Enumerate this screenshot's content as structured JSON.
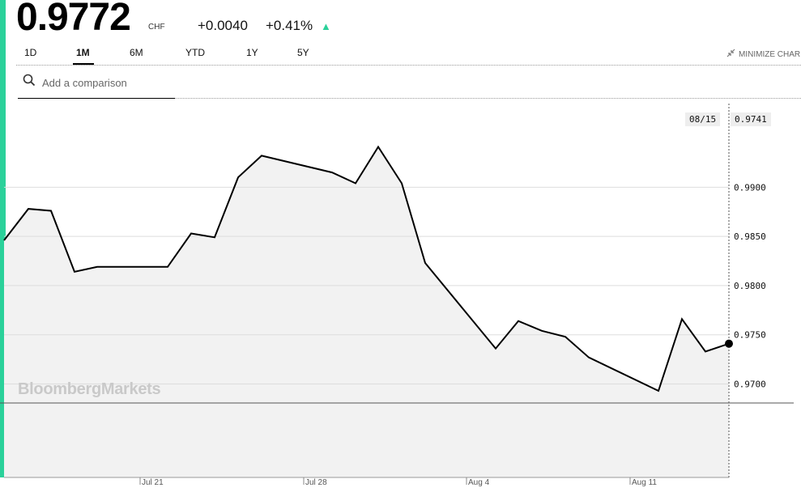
{
  "quote": {
    "price": "0.9772",
    "currency": "CHF",
    "change": "+0.0040",
    "change_pct": "+0.41%",
    "arrow": "▲",
    "accent_color": "#2bd19a",
    "up_color": "#2bd19a"
  },
  "ranges": {
    "items": [
      "1D",
      "1M",
      "6M",
      "YTD",
      "1Y",
      "5Y"
    ],
    "active": "1M"
  },
  "minimize_label": "MINIMIZE CHAR",
  "minimize_icon": "minimize-arrows-icon",
  "search": {
    "placeholder": "Add a comparison",
    "icon": "search-icon"
  },
  "watermark": "BloombergMarkets",
  "crosshair": {
    "date": "08/15",
    "value": "0.9741"
  },
  "chart_data": {
    "type": "area",
    "x": [
      "Jul 17",
      "Jul 18",
      "Jul 19",
      "Jul 20",
      "Jul 21",
      "Jul 24",
      "Jul 25",
      "Jul 26",
      "Jul 27",
      "Jul 28",
      "Jul 31",
      "Aug 1",
      "Aug 2",
      "Aug 3",
      "Aug 4",
      "Aug 7",
      "Aug 8",
      "Aug 9",
      "Aug 10",
      "Aug 11",
      "Aug 14",
      "Aug 15"
    ],
    "series": [
      {
        "values": [
          0.9846,
          0.9878,
          0.9876,
          0.9814,
          0.9819,
          0.9819,
          0.9853,
          0.9849,
          0.991,
          0.9932,
          0.9915,
          0.9904,
          0.9941,
          0.9904,
          0.9823,
          0.9736,
          0.9764,
          0.9754,
          0.9748,
          0.9727,
          0.9693,
          0.9766,
          0.9733,
          0.9741
        ]
      }
    ],
    "x_ticks": [
      "Jul 21",
      "Jul 28",
      "Aug 4",
      "Aug 11"
    ],
    "y_ticks": [
      "0.9900",
      "0.9850",
      "0.9800",
      "0.9750",
      "0.9700"
    ],
    "ylim": [
      0.9605,
      0.9985
    ],
    "grid": true,
    "line_color": "#000000",
    "fill_color": "#f2f2f2",
    "grid_color": "#dddddd"
  }
}
